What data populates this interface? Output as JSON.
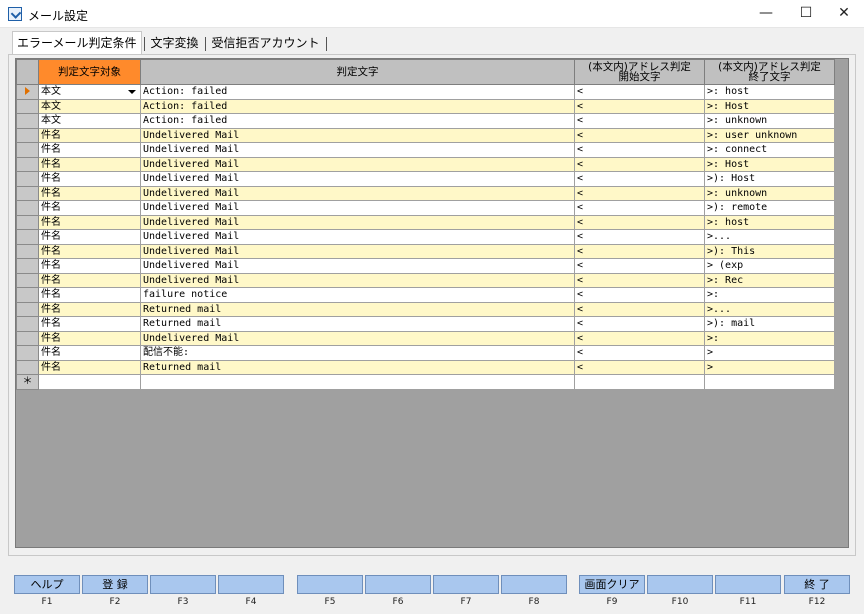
{
  "window": {
    "title": "メール設定",
    "minimize": "—",
    "maximize": "☐",
    "close": "✕"
  },
  "tabs": [
    "エラーメール判定条件",
    "文字変換",
    "受信拒否アカウント"
  ],
  "grid": {
    "headers": {
      "target": "判定文字対象",
      "match": "判定文字",
      "start_line1": "(本文内)アドレス判定",
      "start_line2": "開始文字",
      "end_line1": "(本文内)アドレス判定",
      "end_line2": "終了文字"
    },
    "new_row_marker": "＊",
    "rows": [
      [
        "本文",
        "Action: failed",
        "<",
        ">: host"
      ],
      [
        "本文",
        "Action: failed",
        "<",
        ">: Host"
      ],
      [
        "本文",
        "Action: failed",
        "<",
        ">: unknown"
      ],
      [
        "件名",
        "Undelivered Mail",
        "<",
        ">: user unknown"
      ],
      [
        "件名",
        "Undelivered Mail",
        "<",
        ">: connect"
      ],
      [
        "件名",
        "Undelivered Mail",
        "<",
        ">: Host"
      ],
      [
        "件名",
        "Undelivered Mail",
        "<",
        ">): Host"
      ],
      [
        "件名",
        "Undelivered Mail",
        "<",
        ">: unknown"
      ],
      [
        "件名",
        "Undelivered Mail",
        "<",
        ">): remote"
      ],
      [
        "件名",
        "Undelivered Mail",
        "<",
        ">: host"
      ],
      [
        "件名",
        "Undelivered Mail",
        "<",
        ">..."
      ],
      [
        "件名",
        "Undelivered Mail",
        "<",
        ">): This"
      ],
      [
        "件名",
        "Undelivered Mail",
        "<",
        "> (exp"
      ],
      [
        "件名",
        "Undelivered Mail",
        "<",
        ">: Rec"
      ],
      [
        "件名",
        "failure notice",
        "<",
        ">:"
      ],
      [
        "件名",
        "Returned mail",
        "<",
        ">..."
      ],
      [
        "件名",
        "Returned mail",
        "<",
        ">): mail"
      ],
      [
        "件名",
        "Undelivered Mail",
        "<",
        ">:"
      ],
      [
        "件名",
        "配信不能:",
        "<",
        ">"
      ],
      [
        "件名",
        "Returned mail",
        "<",
        ">"
      ]
    ]
  },
  "fkeys": [
    {
      "label": "ヘルプ",
      "key": "F1"
    },
    {
      "label": "登 録",
      "key": "F2"
    },
    {
      "label": "",
      "key": "F3"
    },
    {
      "label": "",
      "key": "F4"
    },
    {
      "label": "",
      "key": "F5"
    },
    {
      "label": "",
      "key": "F6"
    },
    {
      "label": "",
      "key": "F7"
    },
    {
      "label": "",
      "key": "F8"
    },
    {
      "label": "画面クリア",
      "key": "F9"
    },
    {
      "label": "",
      "key": "F10"
    },
    {
      "label": "",
      "key": "F11"
    },
    {
      "label": "終 了",
      "key": "F12"
    }
  ]
}
